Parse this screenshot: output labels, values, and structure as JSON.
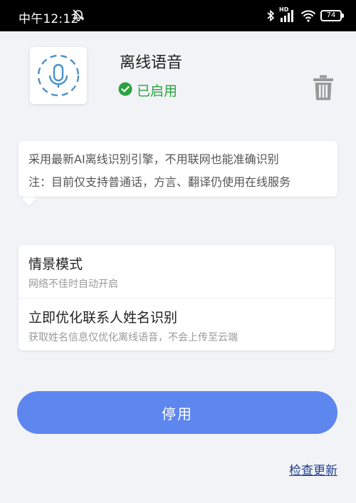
{
  "status_bar": {
    "time": "中午12:12",
    "network_badge": "HD",
    "battery": "74",
    "icons": [
      "mute-icon",
      "bluetooth-icon",
      "signal-icon",
      "wifi-icon",
      "battery-icon"
    ]
  },
  "feature": {
    "title": "离线语音",
    "status_text": "已启用",
    "status_color": "#2aa33f",
    "app_icon": "microphone-icon",
    "delete_icon": "trash-icon"
  },
  "info": {
    "line1": "采用最新AI离线识别引擎，不用联网也能准确识别",
    "line2": "注：目前仅支持普通话，方言、翻译仍使用在线服务"
  },
  "settings": [
    {
      "title": "情景模式",
      "subtitle": "网络不佳时自动开启"
    },
    {
      "title": "立即优化联系人姓名识别",
      "subtitle": "获取姓名信息仅优化离线语音，不会上传至云端"
    }
  ],
  "actions": {
    "disable_label": "停用",
    "check_update_label": "检查更新",
    "accent_color": "#5d86ee"
  }
}
